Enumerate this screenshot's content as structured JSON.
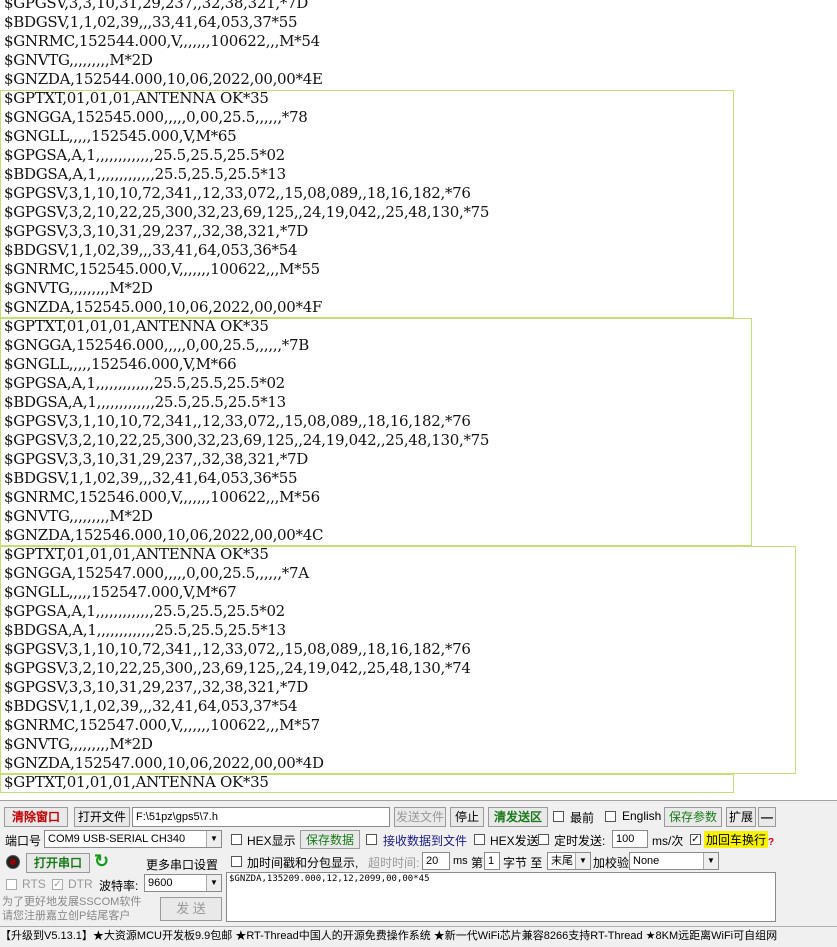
{
  "log_lines": [
    "$GPGSV,3,3,10,31,29,237,,32,38,321,*7D",
    "$BDGSV,1,1,02,39,,,33,41,64,053,37*55",
    "$GNRMC,152544.000,V,,,,,,,100622,,,M*54",
    "$GNVTG,,,,,,,,,M*2D",
    "$GNZDA,152544.000,10,06,2022,00,00*4E",
    "$GPTXT,01,01,01,ANTENNA OK*35",
    "$GNGGA,152545.000,,,,,0,00,25.5,,,,,,*78",
    "$GNGLL,,,,,152545.000,V,M*65",
    "$GPGSA,A,1,,,,,,,,,,,,,25.5,25.5,25.5*02",
    "$BDGSA,A,1,,,,,,,,,,,,,25.5,25.5,25.5*13",
    "$GPGSV,3,1,10,10,72,341,,12,33,072,,15,08,089,,18,16,182,*76",
    "$GPGSV,3,2,10,22,25,300,32,23,69,125,,24,19,042,,25,48,130,*75",
    "$GPGSV,3,3,10,31,29,237,,32,38,321,*7D",
    "$BDGSV,1,1,02,39,,,33,41,64,053,36*54",
    "$GNRMC,152545.000,V,,,,,,,100622,,,M*55",
    "$GNVTG,,,,,,,,,M*2D",
    "$GNZDA,152545.000,10,06,2022,00,00*4F",
    "$GPTXT,01,01,01,ANTENNA OK*35",
    "$GNGGA,152546.000,,,,,0,00,25.5,,,,,,*7B",
    "$GNGLL,,,,,152546.000,V,M*66",
    "$GPGSA,A,1,,,,,,,,,,,,,25.5,25.5,25.5*02",
    "$BDGSA,A,1,,,,,,,,,,,,,25.5,25.5,25.5*13",
    "$GPGSV,3,1,10,10,72,341,,12,33,072,,15,08,089,,18,16,182,*76",
    "$GPGSV,3,2,10,22,25,300,32,23,69,125,,24,19,042,,25,48,130,*75",
    "$GPGSV,3,3,10,31,29,237,,32,38,321,*7D",
    "$BDGSV,1,1,02,39,,,32,41,64,053,36*55",
    "$GNRMC,152546.000,V,,,,,,,100622,,,M*56",
    "$GNVTG,,,,,,,,,M*2D",
    "$GNZDA,152546.000,10,06,2022,00,00*4C",
    "$GPTXT,01,01,01,ANTENNA OK*35",
    "$GNGGA,152547.000,,,,,0,00,25.5,,,,,,*7A",
    "$GNGLL,,,,,152547.000,V,M*67",
    "$GPGSA,A,1,,,,,,,,,,,,,25.5,25.5,25.5*02",
    "$BDGSA,A,1,,,,,,,,,,,,,25.5,25.5,25.5*13",
    "$GPGSV,3,1,10,10,72,341,,12,33,072,,15,08,089,,18,16,182,*76",
    "$GPGSV,3,2,10,22,25,300,,23,69,125,,24,19,042,,25,48,130,*74",
    "$GPGSV,3,3,10,31,29,237,,32,38,321,*7D",
    "$BDGSV,1,1,02,39,,,32,41,64,053,37*54",
    "$GNRMC,152547.000,V,,,,,,,100622,,,M*57",
    "$GNVTG,,,,,,,,,M*2D",
    "$GNZDA,152547.000,10,06,2022,00,00*4D",
    "$GPTXT,01,01,01,ANTENNA OK*35"
  ],
  "highlight_color": "#c6de7a",
  "toolbar": {
    "clear_window": "清除窗口",
    "open_file": "打开文件",
    "file_path": "F:\\51pz\\gps5\\7.h",
    "send_file": "发送文件",
    "stop": "停止",
    "clear_send_area": "清发送区",
    "topmost": "最前",
    "english": "English",
    "save_params": "保存参数",
    "expand": "扩展",
    "collapse": "—"
  },
  "port": {
    "label": "端口号",
    "value": "COM9 USB-SERIAL CH340",
    "open_button": "打开串口",
    "more_settings": "更多串口设置",
    "rts": "RTS",
    "dtr": "DTR",
    "baud_label": "波特率:",
    "baud_value": "9600"
  },
  "options": {
    "hex_display": "HEX显示",
    "save_data": "保存数据",
    "recv_to_file": "接收数据到文件",
    "hex_send": "HEX发送",
    "timed_send": "定时发送:",
    "interval_value": "100",
    "interval_unit": "ms/次",
    "add_crlf": "加回车换行",
    "timestamp": "加时间戳和分包显示,",
    "timeout_label": "超时时间:",
    "timeout_value": "20",
    "timeout_unit": "ms",
    "byte_prefix": "第",
    "byte_from": "1",
    "byte_mid": "字节 至",
    "byte_to": "末尾",
    "checksum_label": "加校验",
    "checksum_value": "None"
  },
  "send": {
    "text": "$GNZDA,135209.000,12,12,2099,00,00*45",
    "button": "发 送",
    "promo": "为了更好地发展SSCOM软件\n请您注册嘉立创P结尾客户"
  },
  "statusbar": {
    "text": "【升级到V5.13.1】★大资源MCU开发板9.9包邮 ★RT-Thread中国人的开源免费操作系统 ★新一代WiFi芯片兼容8266支持RT-Thread ★8KM远距离WiFi可自组网"
  }
}
